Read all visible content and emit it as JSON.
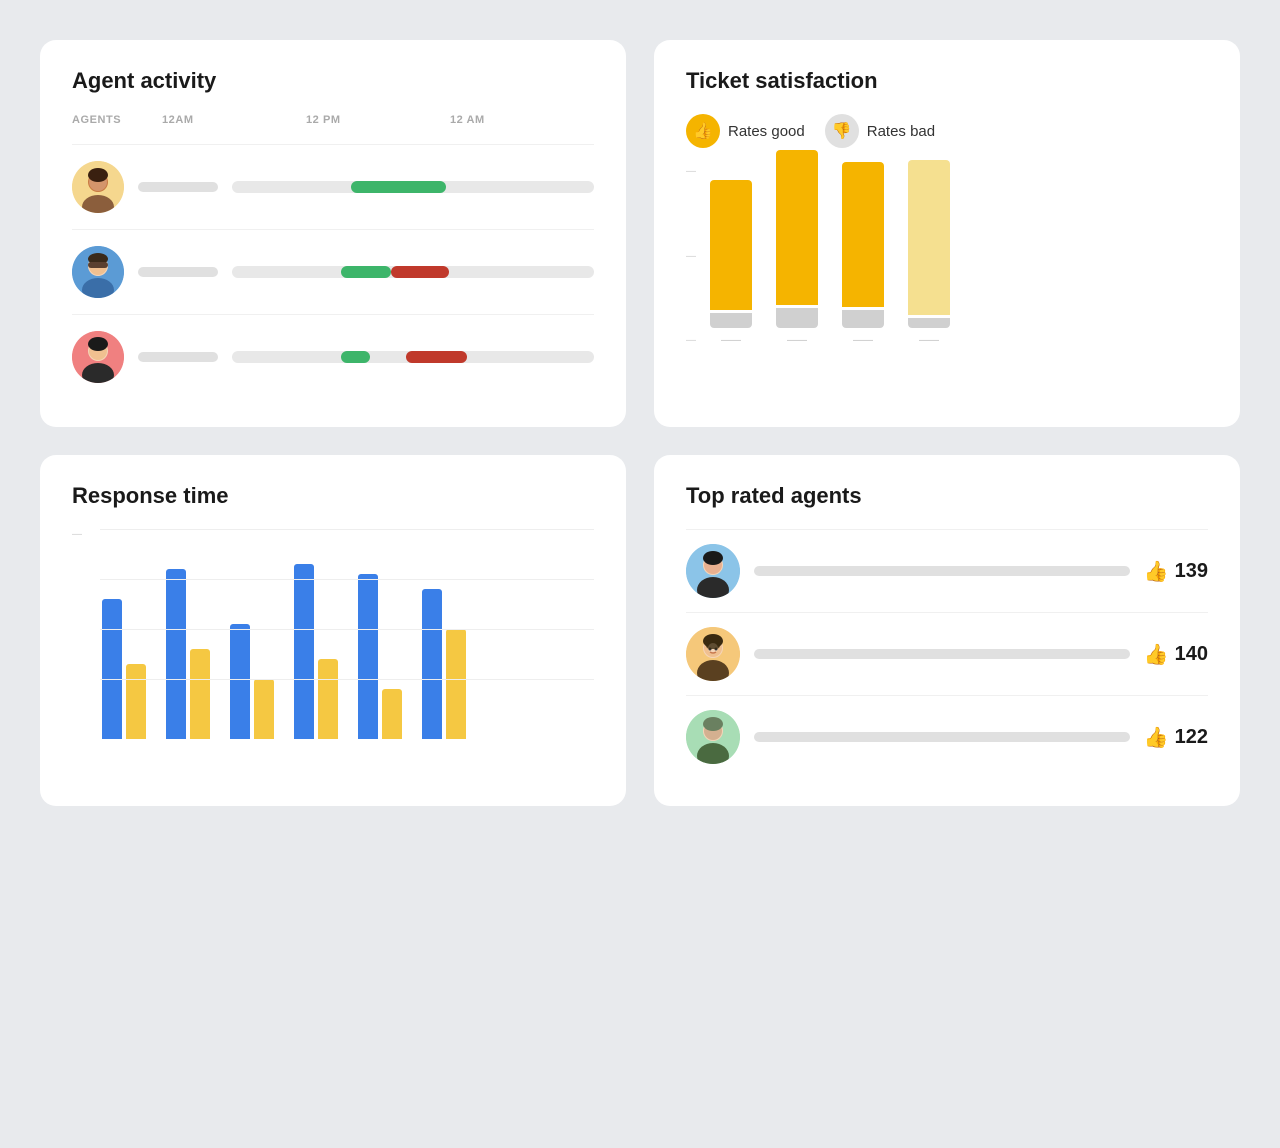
{
  "agentActivity": {
    "title": "Agent activity",
    "header": {
      "col1": "AGENTS",
      "col2": "12AM",
      "col3": "12 PM",
      "col4": "12 AM"
    },
    "agents": [
      {
        "id": "agent-1",
        "avatarBg": "#f5d78e",
        "greenStart": 35,
        "greenWidth": 25,
        "redStart": 0,
        "redWidth": 0
      },
      {
        "id": "agent-2",
        "avatarBg": "#5b9bd5",
        "greenStart": 32,
        "greenWidth": 14,
        "redStart": 46,
        "redWidth": 16
      },
      {
        "id": "agent-3",
        "avatarBg": "#f08080",
        "greenStart": 32,
        "greenWidth": 8,
        "redStart": 50,
        "redWidth": 17
      }
    ]
  },
  "ticketSatisfaction": {
    "title": "Ticket satisfaction",
    "legend": {
      "good_label": "Rates good",
      "bad_label": "Rates bad"
    },
    "chart": {
      "bars": [
        {
          "label": "",
          "good": 130,
          "bad": 15
        },
        {
          "label": "",
          "good": 155,
          "bad": 20
        },
        {
          "label": "",
          "good": 145,
          "bad": 18
        },
        {
          "label": "",
          "good": 160,
          "bad": 10
        }
      ],
      "yLabels": [
        "",
        "",
        "",
        ""
      ]
    }
  },
  "responseTime": {
    "title": "Response time",
    "chart": {
      "groups": [
        {
          "blue": 140,
          "yellow": 75
        },
        {
          "blue": 170,
          "yellow": 90
        },
        {
          "blue": 120,
          "yellow": 60
        },
        {
          "blue": 175,
          "yellow": 80
        },
        {
          "blue": 165,
          "yellow": 50
        },
        {
          "blue": 150,
          "yellow": 110
        }
      ],
      "yLabel": "—"
    }
  },
  "topRatedAgents": {
    "title": "Top rated agents",
    "agents": [
      {
        "id": "top-1",
        "avatarBg": "#8bc4e8",
        "score": "139"
      },
      {
        "id": "top-2",
        "avatarBg": "#f5c87a",
        "score": "140"
      },
      {
        "id": "top-3",
        "avatarBg": "#a8ddb5",
        "score": "122"
      }
    ]
  }
}
